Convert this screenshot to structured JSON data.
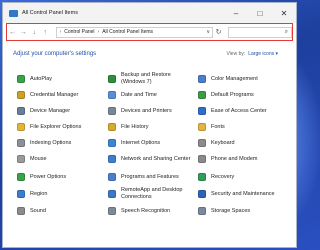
{
  "window": {
    "title": "All Control Panel Items",
    "controls": {
      "minimize": "–",
      "maximize": "□",
      "close": "✕"
    }
  },
  "nav": {
    "back": "←",
    "forward": "→",
    "down": "↓",
    "up": "↑",
    "refresh": "↻"
  },
  "address": {
    "segments": [
      "Control Panel",
      "All Control Panel Items"
    ],
    "separator": "›",
    "dropdown": "∨"
  },
  "search": {
    "icon": "⌕"
  },
  "heading": "Adjust your computer's settings",
  "view_by": {
    "label": "View by:",
    "value": "Large icons ▾"
  },
  "items": [
    {
      "label": "AutoPlay",
      "icon": "autoplay-icon",
      "color": "#3aa34a"
    },
    {
      "label": "Backup and Restore (Windows 7)",
      "icon": "backup-icon",
      "color": "#2d8f3a"
    },
    {
      "label": "Color Management",
      "icon": "color-management-icon",
      "color": "#4a7fd0"
    },
    {
      "label": "Credential Manager",
      "icon": "credential-manager-icon",
      "color": "#c9a227"
    },
    {
      "label": "Date and Time",
      "icon": "date-time-icon",
      "color": "#5a8ed8"
    },
    {
      "label": "Default Programs",
      "icon": "default-programs-icon",
      "color": "#3c9a48"
    },
    {
      "label": "Device Manager",
      "icon": "device-manager-icon",
      "color": "#6b7e96"
    },
    {
      "label": "Devices and Printers",
      "icon": "printer-icon",
      "color": "#7a8796"
    },
    {
      "label": "Ease of Access Center",
      "icon": "ease-of-access-icon",
      "color": "#2f6fc8"
    },
    {
      "label": "File Explorer Options",
      "icon": "folder-options-icon",
      "color": "#e2b53a"
    },
    {
      "label": "File History",
      "icon": "file-history-icon",
      "color": "#d9a92e"
    },
    {
      "label": "Fonts",
      "icon": "fonts-icon",
      "color": "#e0b640"
    },
    {
      "label": "Indexing Options",
      "icon": "indexing-icon",
      "color": "#8a8f99"
    },
    {
      "label": "Internet Options",
      "icon": "internet-options-icon",
      "color": "#3d86d4"
    },
    {
      "label": "Keyboard",
      "icon": "keyboard-icon",
      "color": "#8c8c8c"
    },
    {
      "label": "Mouse",
      "icon": "mouse-icon",
      "color": "#9a9a9a"
    },
    {
      "label": "Network and Sharing Center",
      "icon": "network-icon",
      "color": "#3c7fcf"
    },
    {
      "label": "Phone and Modem",
      "icon": "phone-modem-icon",
      "color": "#8a8a8a"
    },
    {
      "label": "Power Options",
      "icon": "power-options-icon",
      "color": "#3aa34a"
    },
    {
      "label": "Programs and Features",
      "icon": "programs-features-icon",
      "color": "#4c7fcf"
    },
    {
      "label": "Recovery",
      "icon": "recovery-icon",
      "color": "#2f9e59"
    },
    {
      "label": "Region",
      "icon": "region-icon",
      "color": "#3a7ed0"
    },
    {
      "label": "RemoteApp and Desktop Connections",
      "icon": "remoteapp-icon",
      "color": "#3b78c8"
    },
    {
      "label": "Security and Maintenance",
      "icon": "security-icon",
      "color": "#2e64b8"
    },
    {
      "label": "Sound",
      "icon": "sound-icon",
      "color": "#8c8c8c"
    },
    {
      "label": "Speech Recognition",
      "icon": "speech-recognition-icon",
      "color": "#7e8a99"
    },
    {
      "label": "Storage Spaces",
      "icon": "storage-spaces-icon",
      "color": "#7a8a9e"
    }
  ]
}
